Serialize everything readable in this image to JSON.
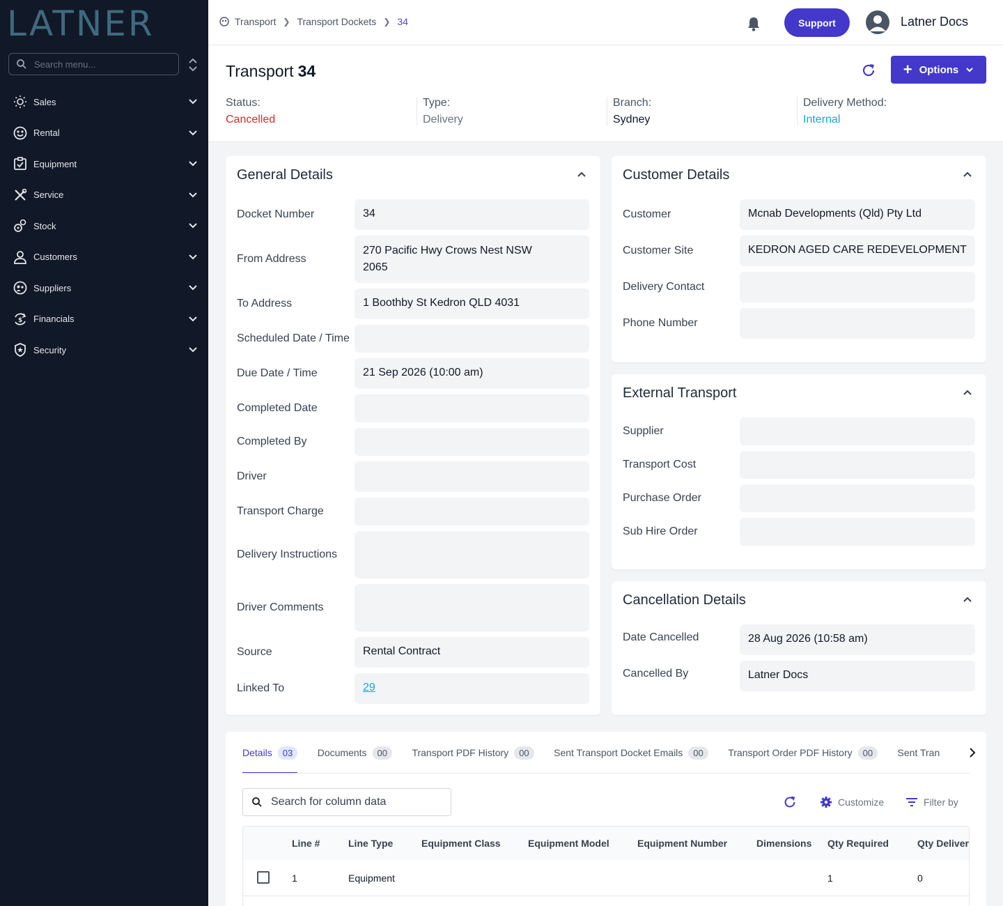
{
  "brand": {
    "logo_text": "LATNER"
  },
  "sidebar": {
    "search_placeholder": "Search menu...",
    "items": [
      {
        "label": "Sales",
        "icon": "sales-icon"
      },
      {
        "label": "Rental",
        "icon": "rental-icon"
      },
      {
        "label": "Equipment",
        "icon": "equipment-icon"
      },
      {
        "label": "Service",
        "icon": "service-icon"
      },
      {
        "label": "Stock",
        "icon": "stock-icon"
      },
      {
        "label": "Customers",
        "icon": "user-icon"
      },
      {
        "label": "Suppliers",
        "icon": "suppliers-icon"
      },
      {
        "label": "Financials",
        "icon": "financials-icon"
      },
      {
        "label": "Security",
        "icon": "shield-icon"
      }
    ]
  },
  "topbar": {
    "breadcrumb": [
      "Transport",
      "Transport Dockets",
      "34"
    ],
    "support_label": "Support",
    "user_name": "Latner Docs"
  },
  "header": {
    "title": "Transport",
    "number": "34",
    "options_label": "Options",
    "meta": [
      {
        "label": "Status:",
        "value": "Cancelled",
        "color": "#dc2626"
      },
      {
        "label": "Type:",
        "value": "Delivery",
        "color": "#6b7280"
      },
      {
        "label": "Branch:",
        "value": "Sydney",
        "color": "#111827"
      },
      {
        "label": "Delivery Method:",
        "value": "Internal",
        "color": "#0ea5e9"
      }
    ]
  },
  "general": {
    "title": "General Details",
    "fields": [
      {
        "label": "Docket Number",
        "value": "34"
      },
      {
        "label": "From Address",
        "value": "270 Pacific Hwy Crows Nest NSW 2065"
      },
      {
        "label": "To Address",
        "value": "1 Boothby St Kedron QLD 4031"
      },
      {
        "label": "Scheduled Date / Time",
        "value": ""
      },
      {
        "label": "Due Date / Time",
        "value": "21 Sep 2026 (10:00 am)"
      },
      {
        "label": "Completed Date",
        "value": ""
      },
      {
        "label": "Completed By",
        "value": ""
      },
      {
        "label": "Driver",
        "value": ""
      },
      {
        "label": "Transport Charge",
        "value": ""
      },
      {
        "label": "Delivery Instructions",
        "value": ""
      },
      {
        "label": "Driver Comments",
        "value": ""
      },
      {
        "label": "Source",
        "value": "Rental Contract"
      },
      {
        "label": "Linked To",
        "value": "29"
      }
    ]
  },
  "customer": {
    "title": "Customer Details",
    "fields": [
      {
        "label": "Customer",
        "value": "Mcnab Developments (Qld) Pty Ltd"
      },
      {
        "label": "Customer Site",
        "value": "KEDRON AGED CARE REDEVELOPMENT"
      },
      {
        "label": "Delivery Contact",
        "value": ""
      },
      {
        "label": "Phone Number",
        "value": ""
      }
    ]
  },
  "external": {
    "title": "External Transport",
    "fields": [
      {
        "label": "Supplier",
        "value": ""
      },
      {
        "label": "Transport Cost",
        "value": ""
      },
      {
        "label": "Purchase Order",
        "value": ""
      },
      {
        "label": "Sub Hire Order",
        "value": ""
      }
    ]
  },
  "cancellation": {
    "title": "Cancellation Details",
    "fields": [
      {
        "label": "Date Cancelled",
        "value": "28 Aug 2026 (10:58 am)"
      },
      {
        "label": "Cancelled By",
        "value": "Latner Docs"
      }
    ]
  },
  "tabs": [
    {
      "label": "Details",
      "count": "03"
    },
    {
      "label": "Documents",
      "count": "00"
    },
    {
      "label": "Transport PDF History",
      "count": "00"
    },
    {
      "label": "Sent Transport Docket Emails",
      "count": "00"
    },
    {
      "label": "Transport Order PDF History",
      "count": "00"
    },
    {
      "label": "Sent Tran",
      "count": ""
    }
  ],
  "table": {
    "search_placeholder": "Search for column data",
    "customize_label": "Customize",
    "filter_label": "Filter by",
    "columns": [
      "Line #",
      "Line Type",
      "Equipment Class",
      "Equipment Model",
      "Equipment Number",
      "Dimensions",
      "Qty Required",
      "Qty Deliver"
    ],
    "rows": [
      [
        "1",
        "Equipment",
        "",
        "",
        "",
        "",
        "1",
        "0"
      ]
    ]
  },
  "colors": {
    "accent": "#4338ca",
    "sidebar_bg": "#111827",
    "danger": "#dc2626",
    "link": "#0ea5e9"
  }
}
